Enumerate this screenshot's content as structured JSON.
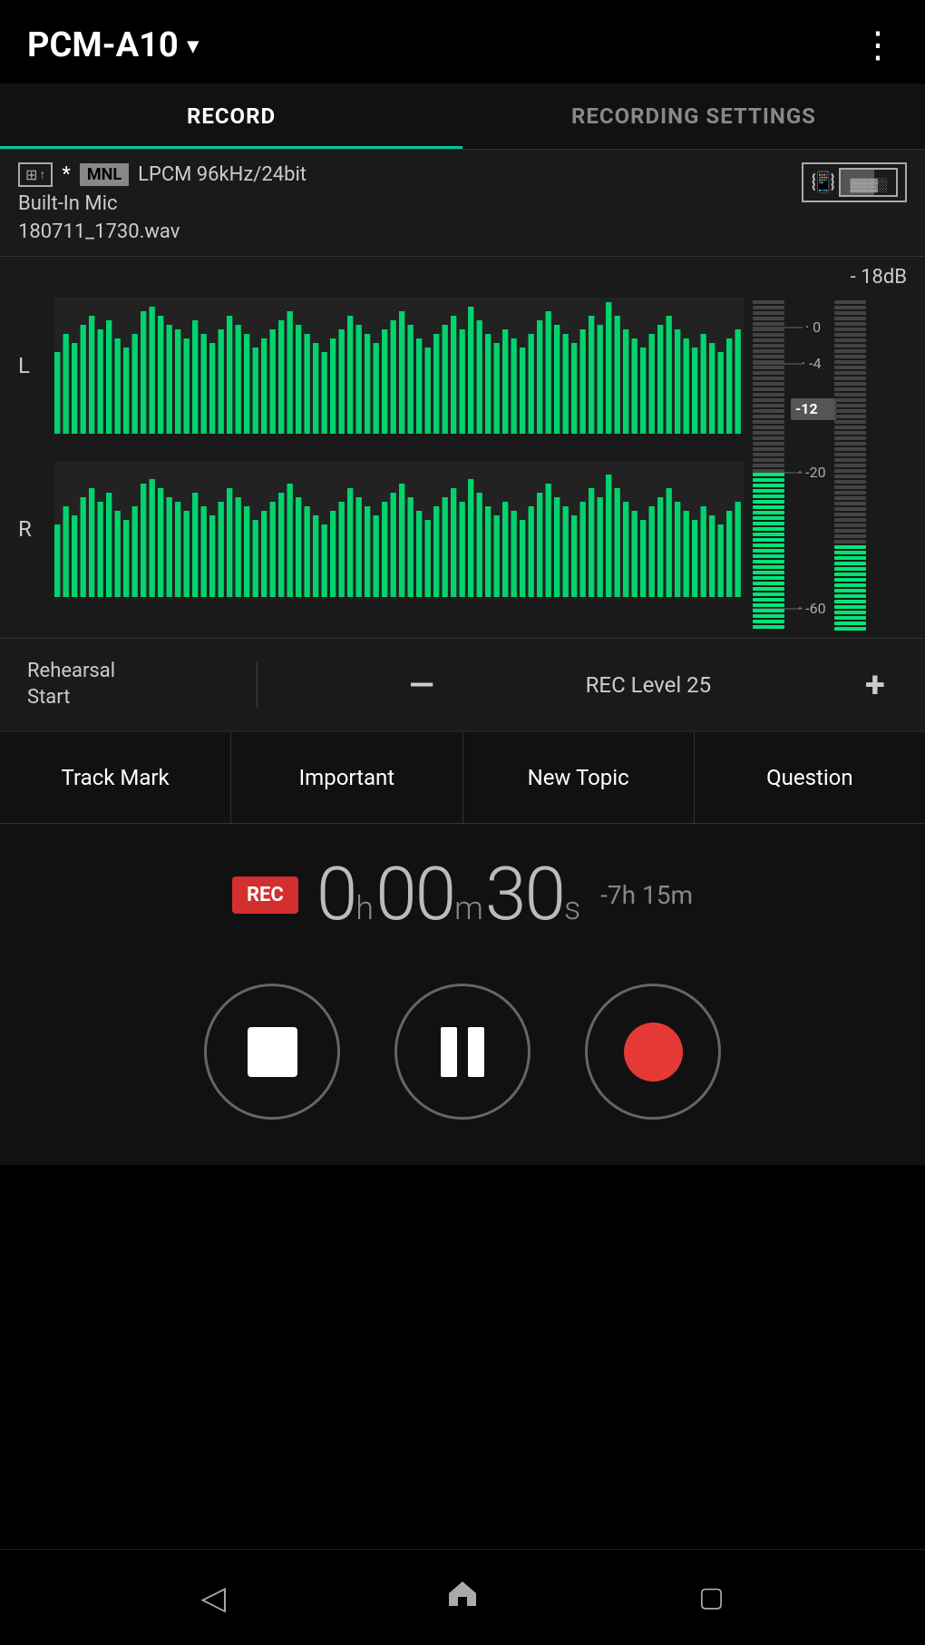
{
  "header": {
    "title": "PCM-A10",
    "more_menu": "⋮"
  },
  "tabs": [
    {
      "label": "RECORD",
      "active": true
    },
    {
      "label": "RECORDING SETTINGS",
      "active": false
    }
  ],
  "info_bar": {
    "format": "LPCM 96kHz/24bit",
    "mic": "Built-In Mic",
    "filename": "180711_1730.wav",
    "mnl": "MNL",
    "db_label": "- 18dB"
  },
  "vu_scale": [
    "0",
    "-4",
    "-12",
    "-20",
    "-60"
  ],
  "rec_level": {
    "rehearsal_line1": "Rehearsal",
    "rehearsal_line2": "Start",
    "level_label": "REC Level 25",
    "minus": "—",
    "plus": "+"
  },
  "mark_buttons": [
    {
      "label": "Track Mark"
    },
    {
      "label": "Important"
    },
    {
      "label": "New Topic"
    },
    {
      "label": "Question"
    }
  ],
  "timer": {
    "rec_label": "REC",
    "hours": "0",
    "hours_unit": "h",
    "minutes": "00",
    "minutes_unit": "m",
    "seconds": "30",
    "seconds_unit": "s",
    "remaining": "-7h 15m"
  },
  "controls": {
    "stop_label": "stop",
    "pause_label": "pause",
    "record_label": "record"
  },
  "nav": {
    "back": "◁",
    "home": "⌂",
    "recent": "▢"
  }
}
